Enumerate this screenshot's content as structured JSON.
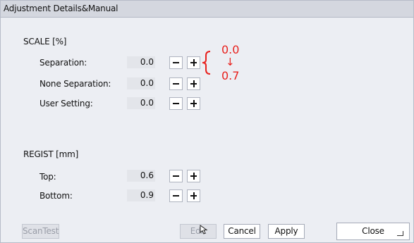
{
  "window": {
    "title": "Adjustment Details&Manual"
  },
  "scale": {
    "heading": "SCALE [%]",
    "rows": [
      {
        "label": "Separation:",
        "value": "0.0"
      },
      {
        "label": "None Separation:",
        "value": "0.0"
      },
      {
        "label": "User Setting:",
        "value": "0.0"
      }
    ]
  },
  "regist": {
    "heading": "REGIST [mm]",
    "rows": [
      {
        "label": "Top:",
        "value": "0.6"
      },
      {
        "label": "Bottom:",
        "value": "0.9"
      }
    ]
  },
  "annotation": {
    "from": "0.0",
    "arrow": "↓",
    "to": "0.7",
    "color": "#e8211d"
  },
  "footer": {
    "scantest": "ScanTest",
    "edit": "Edit",
    "cancel": "Cancel",
    "apply": "Apply",
    "close": "Close"
  }
}
